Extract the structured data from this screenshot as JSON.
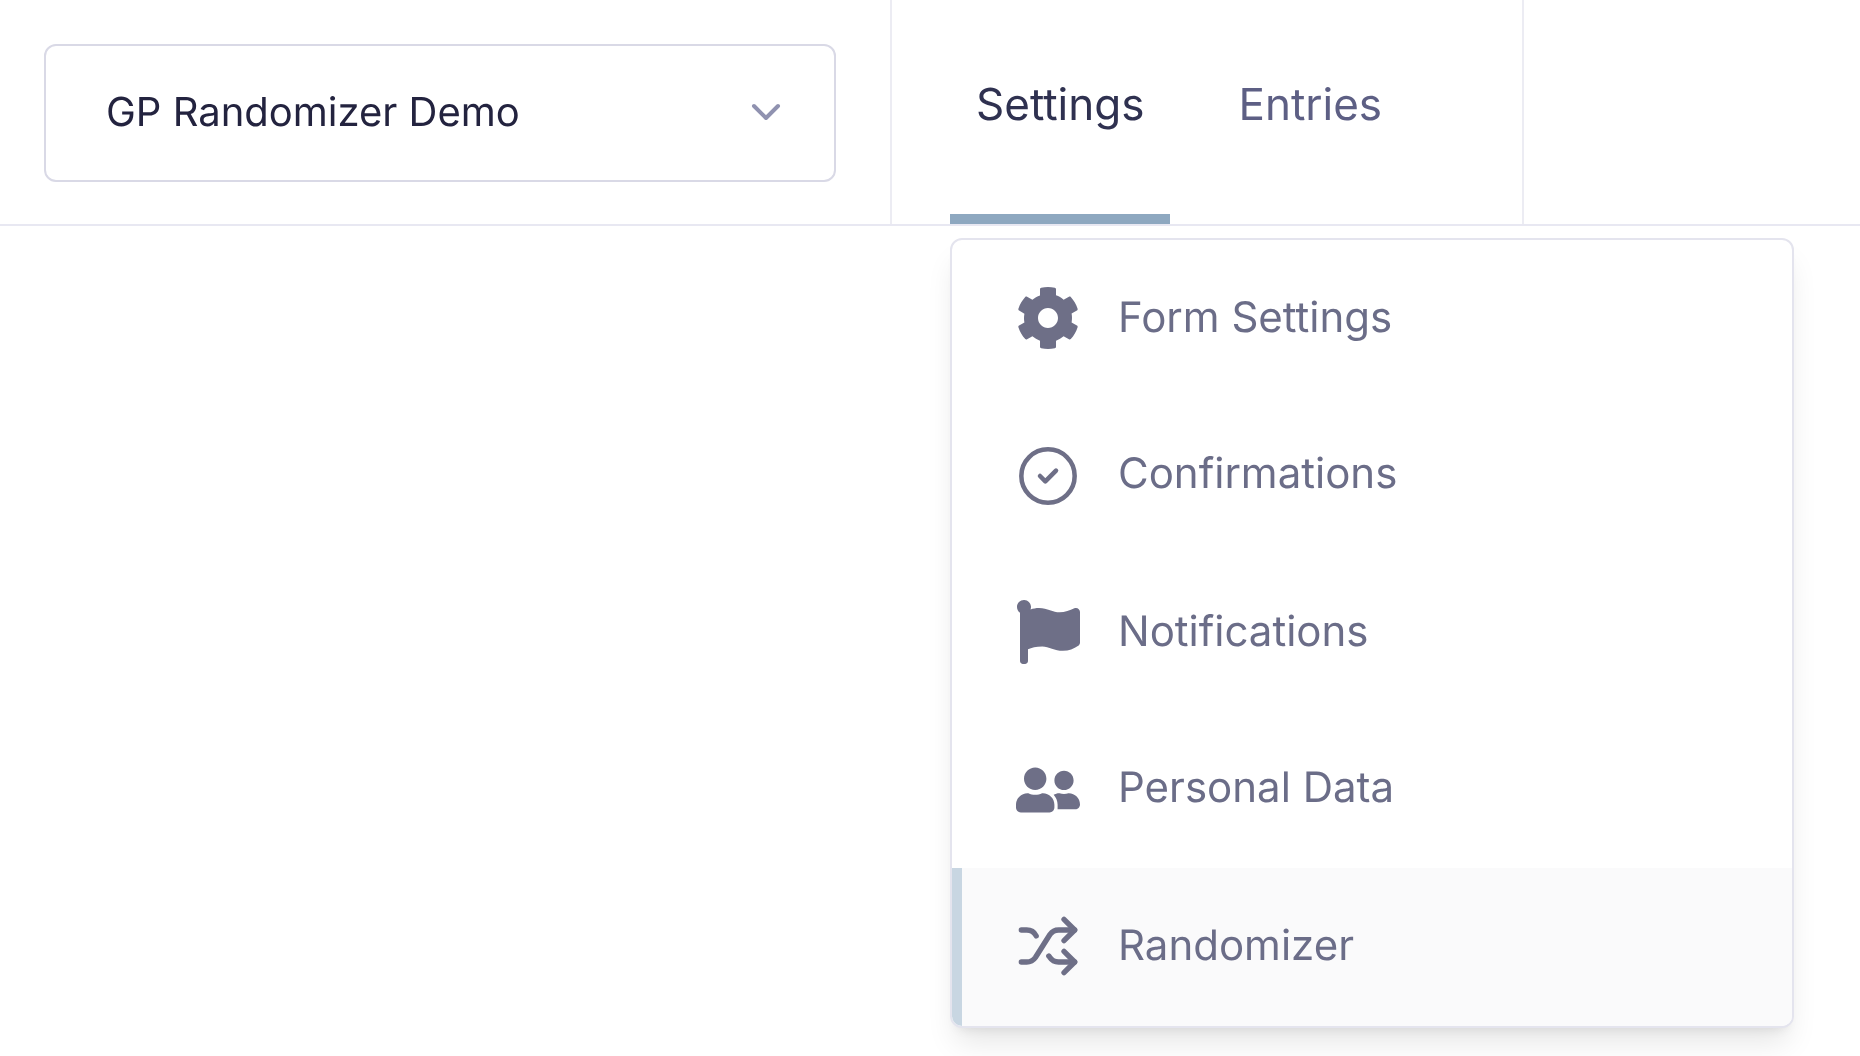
{
  "form_selector": {
    "value": "GP Randomizer Demo"
  },
  "tabs": [
    {
      "label": "Settings",
      "selected": true
    },
    {
      "label": "Entries",
      "selected": false
    }
  ],
  "settings_menu": [
    {
      "label": "Form Settings",
      "selected": false
    },
    {
      "label": "Confirmations",
      "selected": false
    },
    {
      "label": "Notifications",
      "selected": false
    },
    {
      "label": "Personal Data",
      "selected": false
    },
    {
      "label": "Randomizer",
      "selected": true
    }
  ]
}
